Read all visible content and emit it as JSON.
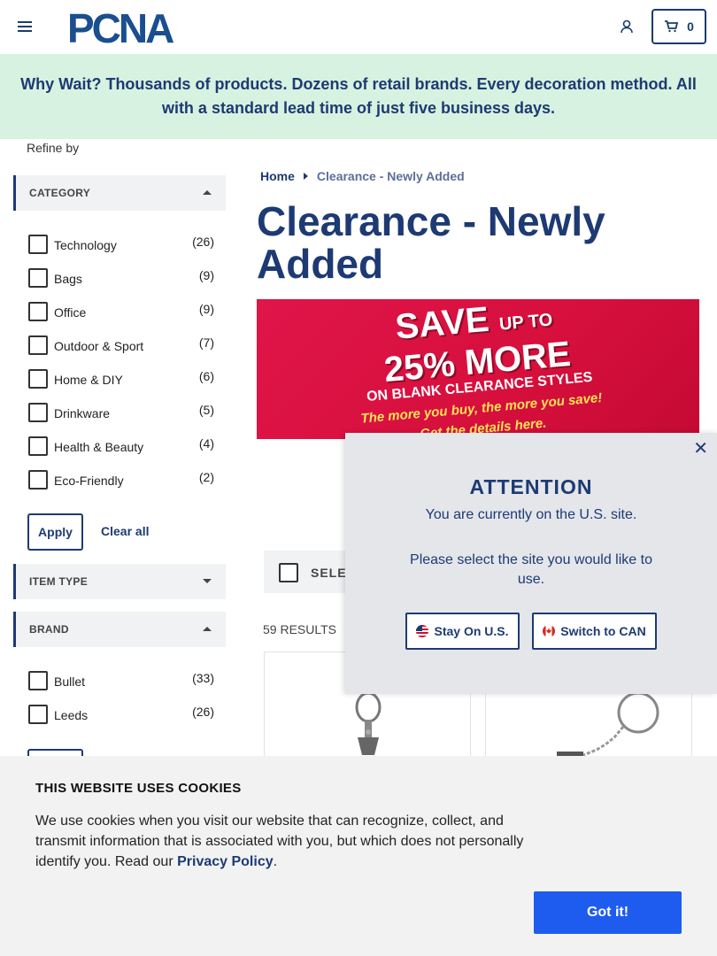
{
  "header": {
    "logo_text": "PCNA",
    "cart_count": "0"
  },
  "promo": {
    "text": "Why Wait? Thousands of products. Dozens of retail brands. Every decoration method. All with a standard lead time of just five business days."
  },
  "sidebar": {
    "refine_label": "Refine by",
    "category": {
      "title": "CATEGORY",
      "items": [
        {
          "label": "Technology",
          "count": "(26)"
        },
        {
          "label": "Bags",
          "count": "(9)"
        },
        {
          "label": "Office",
          "count": "(9)"
        },
        {
          "label": "Outdoor & Sport",
          "count": "(7)"
        },
        {
          "label": "Home & DIY",
          "count": "(6)"
        },
        {
          "label": "Drinkware",
          "count": "(5)"
        },
        {
          "label": "Health & Beauty",
          "count": "(4)"
        },
        {
          "label": "Eco-Friendly",
          "count": "(2)"
        }
      ],
      "apply_label": "Apply",
      "clear_label": "Clear all"
    },
    "item_type": {
      "title": "ITEM TYPE"
    },
    "brand": {
      "title": "BRAND",
      "items": [
        {
          "label": "Bullet",
          "count": "(33)"
        },
        {
          "label": "Leeds",
          "count": "(26)"
        }
      ]
    }
  },
  "main": {
    "breadcrumb": {
      "home": "Home",
      "current": "Clearance - Newly Added"
    },
    "title": "Clearance - Newly Added",
    "hero": {
      "line1_a": "SAVE",
      "line1_b": "UP TO",
      "line2": "25% MORE",
      "line3": "ON BLANK CLEARANCE STYLES",
      "line4": "The more you buy, the more you save!",
      "line5": "Get the details here."
    },
    "select_label": "SELE",
    "results": "59 RESULTS"
  },
  "modal": {
    "title": "ATTENTION",
    "line1": "You are currently on the U.S. site.",
    "line2": "Please select the site you would like to use.",
    "stay_label": "Stay On U.S.",
    "switch_label": "Switch to CAN",
    "close_glyph": "✕"
  },
  "cookie": {
    "title": "THIS WEBSITE USES COOKIES",
    "body": "We use cookies when you visit our website that can recognize, collect, and transmit information that is associated with you, but which does not personally identify you. Read our ",
    "policy_link": "Privacy Policy",
    "body_end": ".",
    "button": "Got it!"
  }
}
